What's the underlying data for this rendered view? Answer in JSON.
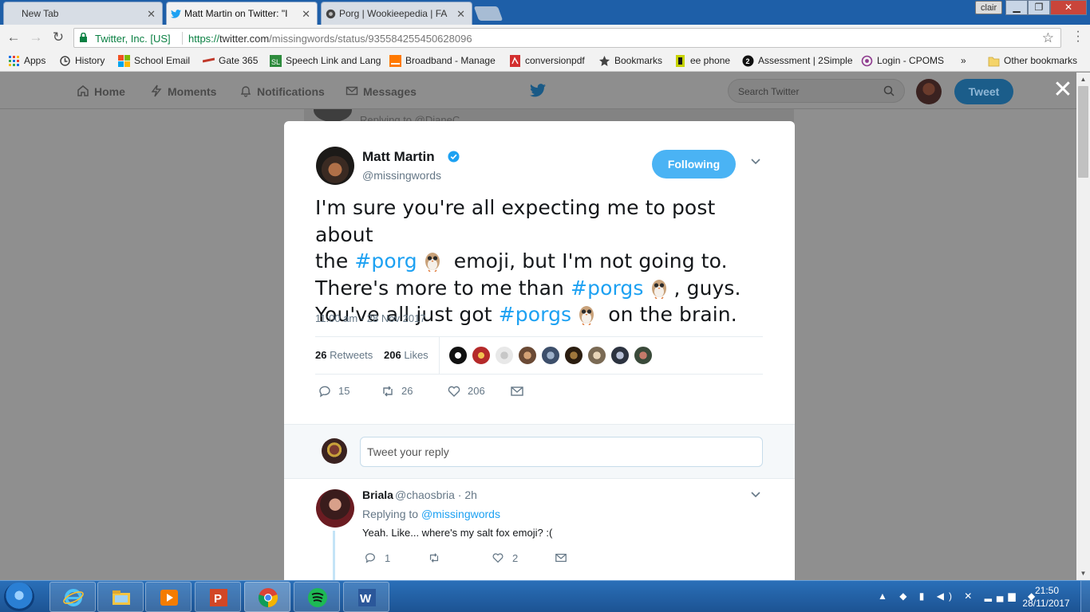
{
  "browser": {
    "tabs": [
      {
        "label": "New Tab"
      },
      {
        "label": "Matt Martin on Twitter: \"I"
      },
      {
        "label": "Porg | Wookieepedia | FA"
      }
    ],
    "profile_name": "clair",
    "secure_label": "Twitter, Inc. [US]",
    "url_prefix": "https://",
    "url_host": "twitter.com",
    "url_path": "/missingwords/status/935584255450628096",
    "bookmarks": [
      {
        "label": "Apps"
      },
      {
        "label": "History"
      },
      {
        "label": "School Email"
      },
      {
        "label": "Gate 365"
      },
      {
        "label": "Speech Link and Lang"
      },
      {
        "label": "Broadband - Manage"
      },
      {
        "label": "conversionpdf"
      },
      {
        "label": "Bookmarks"
      },
      {
        "label": "ee phone"
      },
      {
        "label": "Assessment | 2Simple"
      },
      {
        "label": "Login - CPOMS"
      },
      {
        "label": "»"
      },
      {
        "label": "Other bookmarks"
      }
    ]
  },
  "twitter_nav": {
    "home": "Home",
    "moments": "Moments",
    "notifications": "Notifications",
    "messages": "Messages",
    "search_placeholder": "Search Twitter",
    "tweet_button": "Tweet",
    "background_text": "Replying to @DianeC"
  },
  "tweet": {
    "author_name": "Matt Martin",
    "author_handle": "@missingwords",
    "follow_state": "Following",
    "text": {
      "l1": "I'm sure you're all expecting me to post about",
      "l2a": "the ",
      "l2tag": "#porg",
      "l2b": " emoji, but I'm not going to.",
      "l3a": "There's more to me than ",
      "l3tag": "#porgs",
      "l3b": ", guys.",
      "l4a": "You've all just got ",
      "l4tag": "#porgs",
      "l4b": " on the brain."
    },
    "timestamp": "11:00 am - 28 Nov 2017",
    "retweets_count": "26",
    "retweets_label": "Retweets",
    "likes_count": "206",
    "likes_label": "Likes",
    "actions": {
      "replies": "15",
      "retweets": "26",
      "likes": "206"
    }
  },
  "reply_box": {
    "placeholder": "Tweet your reply"
  },
  "reply": {
    "name": "Briala",
    "handle_meta": "@chaosbria · 2h",
    "replying_label": "Replying to",
    "replying_to": "@missingwords",
    "text": "Yeah. Like... where's my salt fox emoji? :(",
    "actions": {
      "replies": "1",
      "retweets": "",
      "likes": "2"
    }
  },
  "taskbar": {
    "time": "21:50",
    "date": "28/11/2017"
  },
  "colors": {
    "twitter_blue": "#1da1f2",
    "follow_button": "#4ab3f4",
    "secure_green": "#0b8043"
  }
}
